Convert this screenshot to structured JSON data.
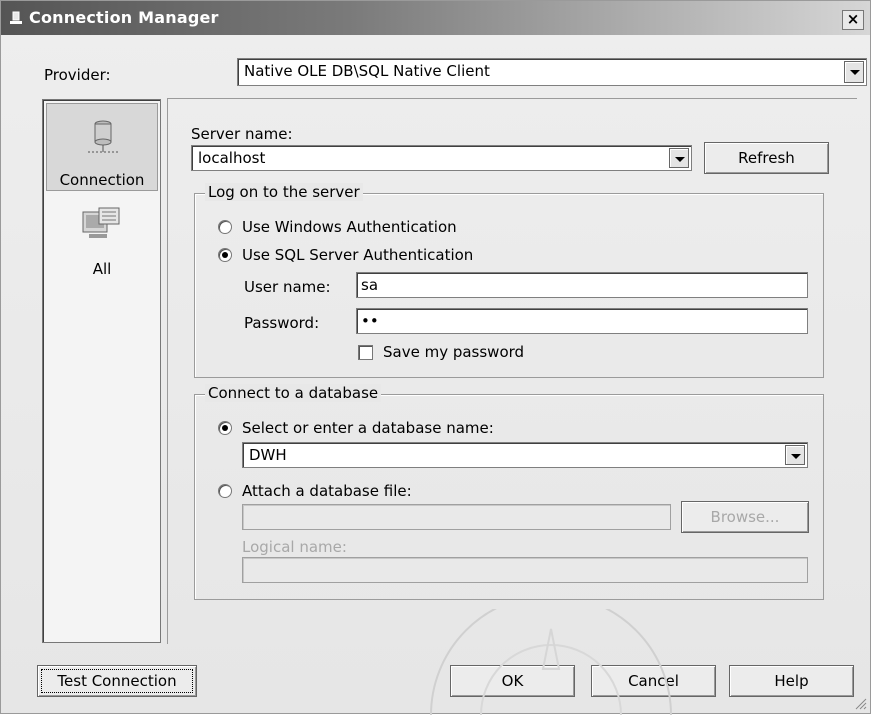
{
  "window": {
    "title": "Connection Manager",
    "close_glyph": "×"
  },
  "provider": {
    "label": "Provider:",
    "value": "Native OLE DB\\SQL Native Client"
  },
  "sidebar": {
    "items": [
      {
        "label": "Connection",
        "icon": "database-icon",
        "selected": true
      },
      {
        "label": "All",
        "icon": "properties-icon",
        "selected": false
      }
    ]
  },
  "server": {
    "label": "Server name:",
    "value": "localhost",
    "refresh_label": "Refresh"
  },
  "logon": {
    "legend": "Log on to the server",
    "windows_auth_label": "Use Windows Authentication",
    "sql_auth_label": "Use SQL Server Authentication",
    "selected": "sql",
    "username_label": "User name:",
    "username_value": "sa",
    "password_label": "Password:",
    "password_value": "••",
    "save_password_label": "Save my password",
    "save_password_checked": false
  },
  "database": {
    "legend": "Connect to a database",
    "select_label": "Select or enter a database name:",
    "select_value": "DWH",
    "attach_label": "Attach a database file:",
    "attach_value": "",
    "browse_label": "Browse...",
    "logical_name_label": "Logical name:",
    "logical_name_value": "",
    "selected": "select"
  },
  "footer": {
    "test_connection_label": "Test Connection",
    "ok_label": "OK",
    "cancel_label": "Cancel",
    "help_label": "Help"
  },
  "colors": {
    "title_gradient_start": "#555555",
    "title_gradient_end": "#d6d6d6",
    "window_bg": "#e8e8e8"
  }
}
